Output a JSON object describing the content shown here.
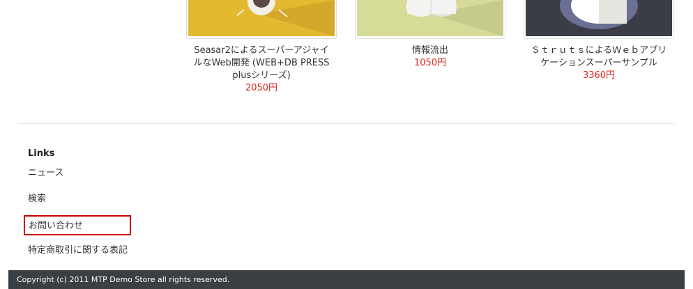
{
  "products": [
    {
      "name": "Seasar2によるスーパーアジャイルなWeb開発 (WEB+DB PRESS plusシリーズ)",
      "price": "2050円",
      "thumb_bg": "#e3b92f",
      "thumb_icon": "coffee-cup-icon"
    },
    {
      "name": "情報流出",
      "price": "1050円",
      "thumb_bg": "#d6dc98",
      "thumb_icon": "cloud-icon"
    },
    {
      "name": "ＳｔｒｕｔｓによるＷｅｂアプリケーションスーパーサンプル",
      "price": "3360円",
      "thumb_bg": "#3a3d46",
      "thumb_icon": "circle-icon"
    }
  ],
  "links": {
    "title": "Links",
    "items": [
      {
        "label": "ニュース"
      },
      {
        "label": "検索"
      },
      {
        "label": "お問い合わせ",
        "highlighted": true
      },
      {
        "label": "特定商取引に関する表記"
      }
    ]
  },
  "footer": {
    "copyright": "Copyright (c) 2011 MTP Demo Store all rights reserved."
  },
  "colors": {
    "price": "#e0261f",
    "footer_bg": "#3a3f44",
    "highlight_border": "#cc0000"
  }
}
